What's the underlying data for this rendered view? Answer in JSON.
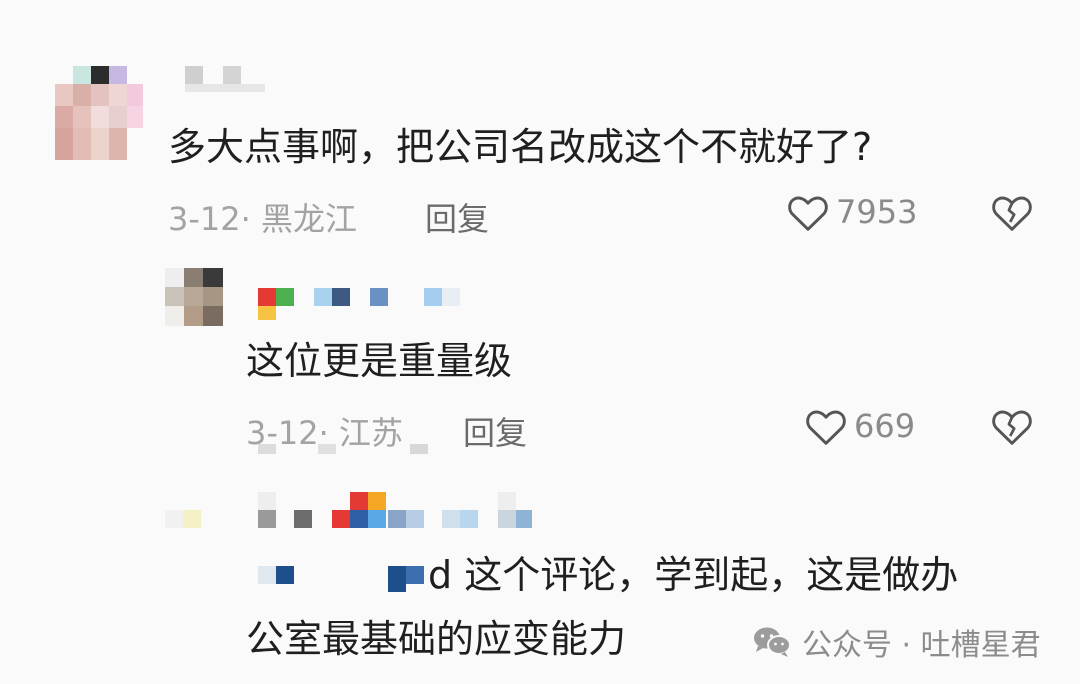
{
  "comments": [
    {
      "text": "多大点事啊，把公司名改成这个不就好了?",
      "date_location": "3-12· 黑龙江",
      "reply_label": "回复",
      "likes": "7953",
      "like_icon": "heart-outline-icon",
      "dislike_icon": "broken-heart-icon"
    },
    {
      "text": "这位更是重量级",
      "date_location": "3-12· 江苏",
      "reply_label": "回复",
      "likes": "669",
      "like_icon": "heart-outline-icon",
      "dislike_icon": "broken-heart-icon"
    },
    {
      "text_line1_tail": "d 这个评论，学到起，这是做办",
      "text_line2": "公室最基础的应变能力"
    }
  ],
  "watermark": {
    "text": "公众号 · 吐槽星君",
    "icon": "wechat-icon"
  }
}
